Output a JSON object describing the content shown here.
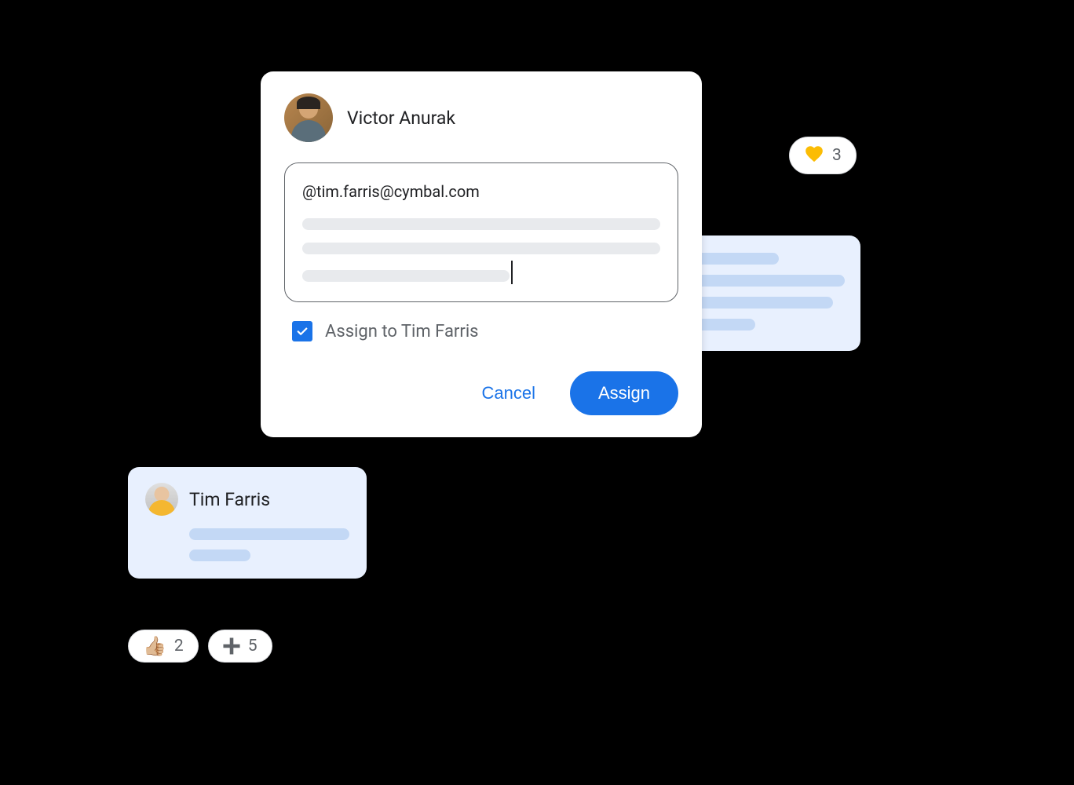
{
  "colors": {
    "primary": "#1a73e8",
    "text": "#202124",
    "muted": "#5f6368",
    "border": "#dadce0",
    "surface_blue": "#e8f0fe",
    "placeholder_gray": "#e8eaed",
    "placeholder_blue": "#c3d8f5"
  },
  "comment": {
    "author": "Victor Anurak",
    "mention": "@tim.farris@cymbal.com",
    "assign_checked": true,
    "assign_label": "Assign to Tim Farris",
    "cancel_label": "Cancel",
    "assign_button_label": "Assign"
  },
  "reply": {
    "author": "Tim Farris"
  },
  "reactions": {
    "heart": {
      "icon": "heart-icon",
      "count": "3"
    },
    "thumbsup": {
      "emoji": "👍🏼",
      "count": "2"
    },
    "plus": {
      "icon": "plus-icon",
      "count": "5"
    }
  }
}
